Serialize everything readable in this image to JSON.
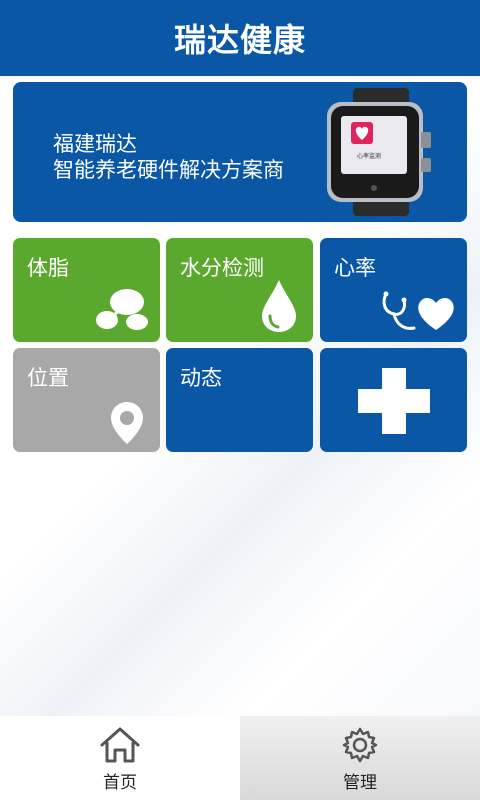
{
  "header": {
    "title": "瑞达健康"
  },
  "banner": {
    "line1": "福建瑞达",
    "line2": "智能养老硬件解决方案商",
    "watch_screen_text": "心率监测"
  },
  "tiles": [
    {
      "label": "体脂",
      "icon": "body-fat-bubbles-icon",
      "color": "#5ba82f"
    },
    {
      "label": "水分检测",
      "icon": "water-drop-icon",
      "color": "#5ba82f"
    },
    {
      "label": "心率",
      "icon": "stethoscope-heart-icon",
      "color": "#0a57a6"
    },
    {
      "label": "位置",
      "icon": "location-pin-icon",
      "color": "#a8a8a8"
    },
    {
      "label": "动态",
      "icon": "",
      "color": "#0a57a6"
    },
    {
      "label": "",
      "icon": "plus-icon",
      "color": "#0a57a6"
    }
  ],
  "tabbar": {
    "home_label": "首页",
    "manage_label": "管理"
  }
}
